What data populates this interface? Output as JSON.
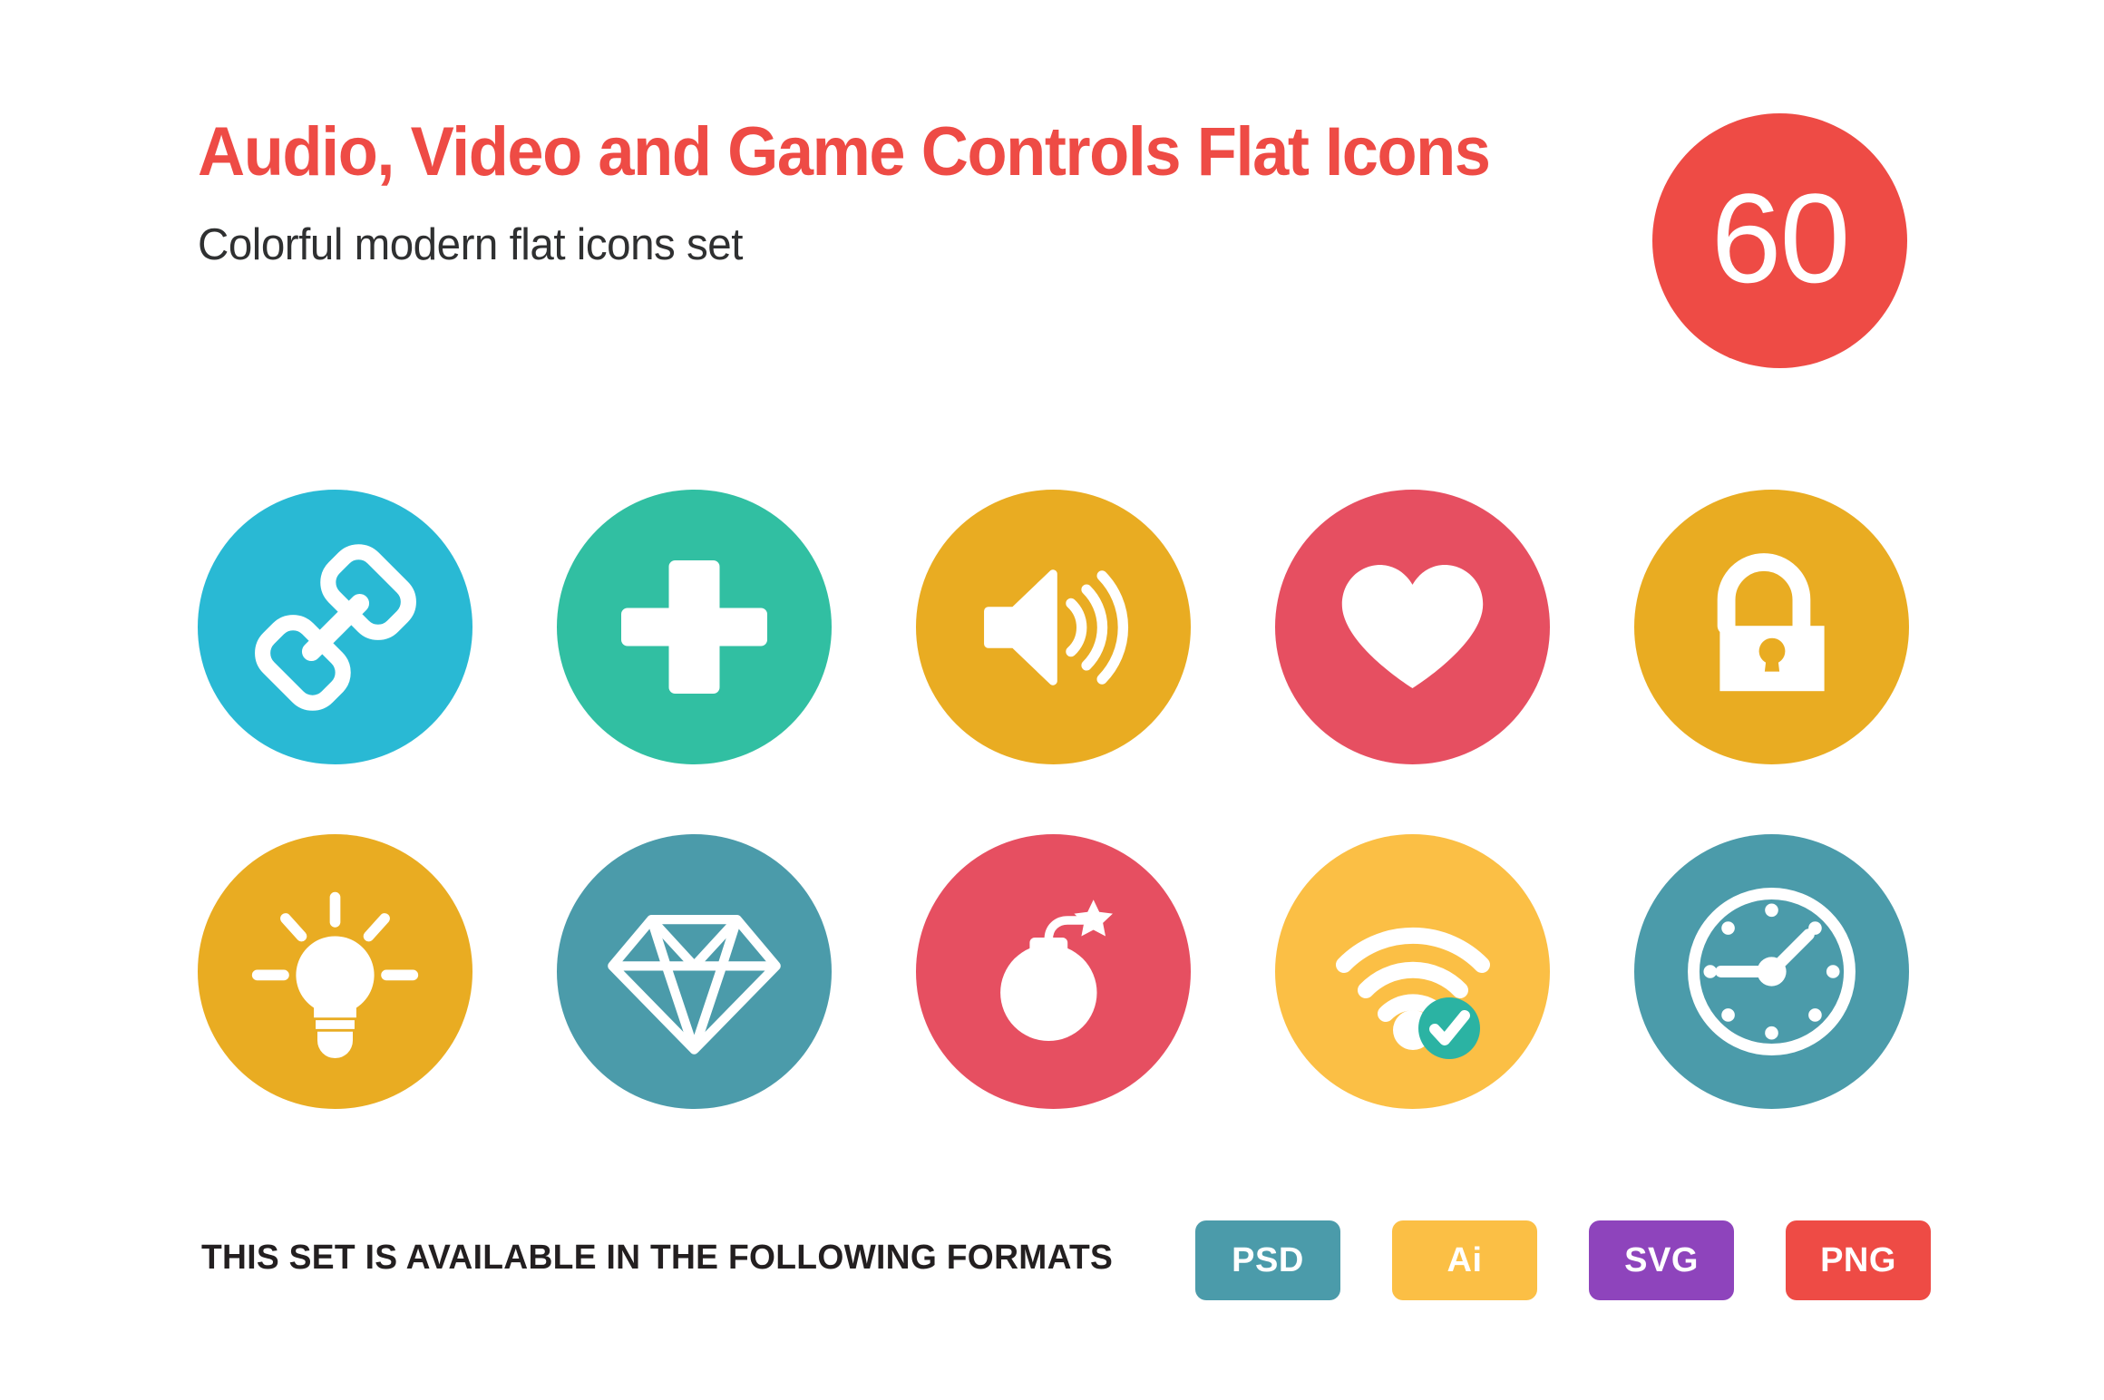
{
  "header": {
    "title": "Audio, Video and Game Controls Flat Icons",
    "subtitle": "Colorful modern flat icons  set",
    "title_color": "#EE4B45",
    "subtitle_color": "#2F3031"
  },
  "count_badge": {
    "value": "60",
    "bg_color": "#EE4B45",
    "text_color": "#FFFFFF"
  },
  "icons": [
    {
      "name": "link-icon",
      "label": "Link",
      "bg_color": "#29B9D4",
      "glyph_color": "#FFFFFF"
    },
    {
      "name": "plus-icon",
      "label": "Plus",
      "bg_color": "#31BFA2",
      "glyph_color": "#FFFFFF"
    },
    {
      "name": "volume-icon",
      "label": "Volume",
      "bg_color": "#E9AC22",
      "glyph_color": "#FFFFFF"
    },
    {
      "name": "heart-icon",
      "label": "Heart",
      "bg_color": "#E64F61",
      "glyph_color": "#FFFFFF"
    },
    {
      "name": "unlock-icon",
      "label": "Unlock",
      "bg_color": "#E9AC22",
      "glyph_color": "#FFFFFF"
    },
    {
      "name": "lightbulb-icon",
      "label": "Light bulb",
      "bg_color": "#E9AC22",
      "glyph_color": "#FFFFFF"
    },
    {
      "name": "diamond-icon",
      "label": "Diamond",
      "bg_color": "#4B9BAA",
      "glyph_color": "#FFFFFF"
    },
    {
      "name": "bomb-icon",
      "label": "Bomb",
      "bg_color": "#E64F61",
      "glyph_color": "#FFFFFF"
    },
    {
      "name": "wifi-check-icon",
      "label": "Wifi verified",
      "bg_color": "#FBBF45",
      "glyph_color": "#FFFFFF",
      "badge_color": "#2BB3A3"
    },
    {
      "name": "clock-icon",
      "label": "Clock",
      "bg_color": "#4B9BAA",
      "glyph_color": "#FFFFFF"
    }
  ],
  "footer": {
    "text": "THIS SET IS AVAILABLE IN THE FOLLOWING FORMATS",
    "text_color": "#231F20",
    "formats": [
      {
        "label": "PSD",
        "color": "#4B9BAA"
      },
      {
        "label": "Ai",
        "color": "#FBBF45"
      },
      {
        "label": "SVG",
        "color": "#8E44BC"
      },
      {
        "label": "PNG",
        "color": "#EE4B45"
      }
    ]
  }
}
